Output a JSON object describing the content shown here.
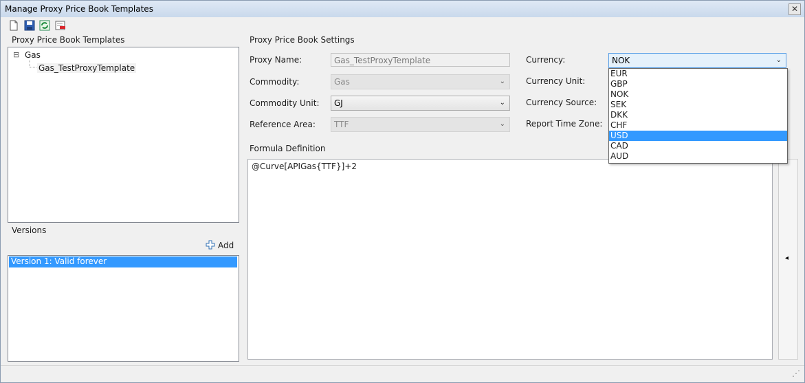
{
  "window": {
    "title": "Manage Proxy Price Book Templates",
    "close_glyph": "✕"
  },
  "toolbar": [
    "new-document-icon",
    "save-icon",
    "refresh-icon",
    "delete-icon"
  ],
  "templates": {
    "title": "Proxy Price Book Templates",
    "tree": {
      "toggle": "⊟",
      "root": "Gas",
      "child": "Gas_TestProxyTemplate"
    }
  },
  "versions": {
    "title": "Versions",
    "add_label": "Add",
    "items": [
      "Version 1: Valid forever"
    ]
  },
  "settings": {
    "title": "Proxy Price Book Settings",
    "proxy_name": {
      "label": "Proxy Name:",
      "value": "Gas_TestProxyTemplate"
    },
    "commodity": {
      "label": "Commodity:",
      "value": "Gas"
    },
    "commodity_unit": {
      "label": "Commodity Unit:",
      "value": "GJ"
    },
    "reference_area": {
      "label": "Reference Area:",
      "value": "TTF"
    },
    "currency": {
      "label": "Currency:",
      "value": "NOK",
      "options": [
        "EUR",
        "GBP",
        "NOK",
        "SEK",
        "DKK",
        "CHF",
        "USD",
        "CAD",
        "AUD"
      ],
      "highlighted": "USD"
    },
    "currency_unit": {
      "label": "Currency Unit:"
    },
    "currency_source": {
      "label": "Currency Source:"
    },
    "report_time_zone": {
      "label": "Report Time Zone:"
    }
  },
  "formula": {
    "title": "Formula Definition",
    "text": "@Curve[APIGas{TTF}]+2",
    "collapse_glyph": "◂"
  },
  "status": {
    "grip": "⋰"
  }
}
